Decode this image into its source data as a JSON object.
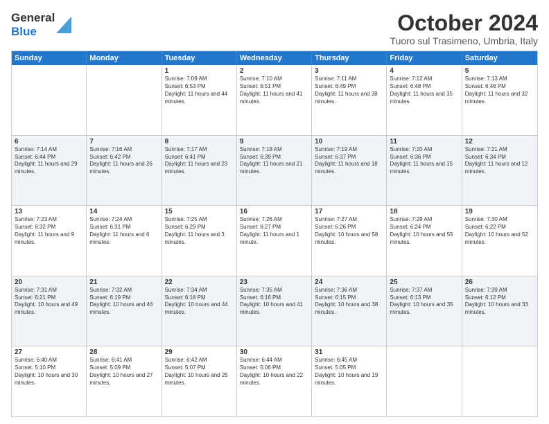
{
  "header": {
    "logo_general": "General",
    "logo_blue": "Blue",
    "month_title": "October 2024",
    "location": "Tuoro sul Trasimeno, Umbria, Italy"
  },
  "days_of_week": [
    "Sunday",
    "Monday",
    "Tuesday",
    "Wednesday",
    "Thursday",
    "Friday",
    "Saturday"
  ],
  "weeks": [
    [
      {
        "day": "",
        "info": ""
      },
      {
        "day": "",
        "info": ""
      },
      {
        "day": "1",
        "info": "Sunrise: 7:09 AM\nSunset: 6:53 PM\nDaylight: 11 hours and 44 minutes."
      },
      {
        "day": "2",
        "info": "Sunrise: 7:10 AM\nSunset: 6:51 PM\nDaylight: 11 hours and 41 minutes."
      },
      {
        "day": "3",
        "info": "Sunrise: 7:11 AM\nSunset: 6:49 PM\nDaylight: 11 hours and 38 minutes."
      },
      {
        "day": "4",
        "info": "Sunrise: 7:12 AM\nSunset: 6:48 PM\nDaylight: 11 hours and 35 minutes."
      },
      {
        "day": "5",
        "info": "Sunrise: 7:13 AM\nSunset: 6:46 PM\nDaylight: 11 hours and 32 minutes."
      }
    ],
    [
      {
        "day": "6",
        "info": "Sunrise: 7:14 AM\nSunset: 6:44 PM\nDaylight: 11 hours and 29 minutes."
      },
      {
        "day": "7",
        "info": "Sunrise: 7:16 AM\nSunset: 6:42 PM\nDaylight: 11 hours and 26 minutes."
      },
      {
        "day": "8",
        "info": "Sunrise: 7:17 AM\nSunset: 6:41 PM\nDaylight: 11 hours and 23 minutes."
      },
      {
        "day": "9",
        "info": "Sunrise: 7:18 AM\nSunset: 6:39 PM\nDaylight: 11 hours and 21 minutes."
      },
      {
        "day": "10",
        "info": "Sunrise: 7:19 AM\nSunset: 6:37 PM\nDaylight: 11 hours and 18 minutes."
      },
      {
        "day": "11",
        "info": "Sunrise: 7:20 AM\nSunset: 6:36 PM\nDaylight: 11 hours and 15 minutes."
      },
      {
        "day": "12",
        "info": "Sunrise: 7:21 AM\nSunset: 6:34 PM\nDaylight: 11 hours and 12 minutes."
      }
    ],
    [
      {
        "day": "13",
        "info": "Sunrise: 7:23 AM\nSunset: 6:32 PM\nDaylight: 11 hours and 9 minutes."
      },
      {
        "day": "14",
        "info": "Sunrise: 7:24 AM\nSunset: 6:31 PM\nDaylight: 11 hours and 6 minutes."
      },
      {
        "day": "15",
        "info": "Sunrise: 7:25 AM\nSunset: 6:29 PM\nDaylight: 11 hours and 3 minutes."
      },
      {
        "day": "16",
        "info": "Sunrise: 7:26 AM\nSunset: 6:27 PM\nDaylight: 11 hours and 1 minute."
      },
      {
        "day": "17",
        "info": "Sunrise: 7:27 AM\nSunset: 6:26 PM\nDaylight: 10 hours and 58 minutes."
      },
      {
        "day": "18",
        "info": "Sunrise: 7:29 AM\nSunset: 6:24 PM\nDaylight: 10 hours and 55 minutes."
      },
      {
        "day": "19",
        "info": "Sunrise: 7:30 AM\nSunset: 6:22 PM\nDaylight: 10 hours and 52 minutes."
      }
    ],
    [
      {
        "day": "20",
        "info": "Sunrise: 7:31 AM\nSunset: 6:21 PM\nDaylight: 10 hours and 49 minutes."
      },
      {
        "day": "21",
        "info": "Sunrise: 7:32 AM\nSunset: 6:19 PM\nDaylight: 10 hours and 46 minutes."
      },
      {
        "day": "22",
        "info": "Sunrise: 7:34 AM\nSunset: 6:18 PM\nDaylight: 10 hours and 44 minutes."
      },
      {
        "day": "23",
        "info": "Sunrise: 7:35 AM\nSunset: 6:16 PM\nDaylight: 10 hours and 41 minutes."
      },
      {
        "day": "24",
        "info": "Sunrise: 7:36 AM\nSunset: 6:15 PM\nDaylight: 10 hours and 38 minutes."
      },
      {
        "day": "25",
        "info": "Sunrise: 7:37 AM\nSunset: 6:13 PM\nDaylight: 10 hours and 35 minutes."
      },
      {
        "day": "26",
        "info": "Sunrise: 7:39 AM\nSunset: 6:12 PM\nDaylight: 10 hours and 33 minutes."
      }
    ],
    [
      {
        "day": "27",
        "info": "Sunrise: 6:40 AM\nSunset: 5:10 PM\nDaylight: 10 hours and 30 minutes."
      },
      {
        "day": "28",
        "info": "Sunrise: 6:41 AM\nSunset: 5:09 PM\nDaylight: 10 hours and 27 minutes."
      },
      {
        "day": "29",
        "info": "Sunrise: 6:42 AM\nSunset: 5:07 PM\nDaylight: 10 hours and 25 minutes."
      },
      {
        "day": "30",
        "info": "Sunrise: 6:44 AM\nSunset: 5:06 PM\nDaylight: 10 hours and 22 minutes."
      },
      {
        "day": "31",
        "info": "Sunrise: 6:45 AM\nSunset: 5:05 PM\nDaylight: 10 hours and 19 minutes."
      },
      {
        "day": "",
        "info": ""
      },
      {
        "day": "",
        "info": ""
      }
    ]
  ]
}
